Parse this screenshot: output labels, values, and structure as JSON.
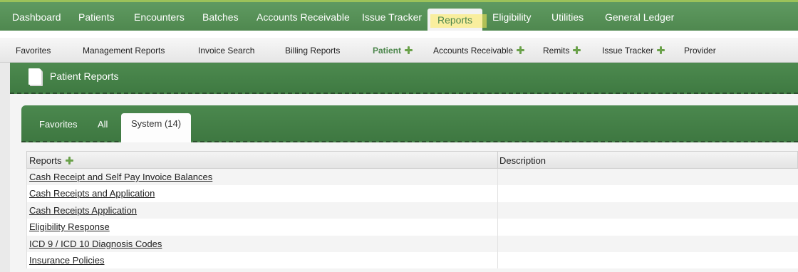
{
  "topnav": {
    "items": [
      {
        "label": "Dashboard"
      },
      {
        "label": "Patients"
      },
      {
        "label": "Encounters"
      },
      {
        "label": "Batches"
      },
      {
        "label": "Accounts Receivable"
      },
      {
        "label": "Issue Tracker"
      },
      {
        "label": "Reports",
        "active": true
      },
      {
        "label": "Eligibility"
      },
      {
        "label": "Utilities"
      },
      {
        "label": "General Ledger"
      }
    ]
  },
  "subnav": {
    "items": [
      {
        "label": "Favorites"
      },
      {
        "label": "Management Reports"
      },
      {
        "label": "Invoice Search"
      },
      {
        "label": "Billing Reports"
      },
      {
        "label": "Patient",
        "active": true,
        "plus": true
      },
      {
        "label": "Accounts Receivable",
        "plus": true
      },
      {
        "label": "Remits",
        "plus": true
      },
      {
        "label": "Issue Tracker",
        "plus": true
      },
      {
        "label": "Provider"
      }
    ]
  },
  "panel": {
    "title": "Patient Reports"
  },
  "tabs": [
    {
      "label": "Favorites"
    },
    {
      "label": "All"
    },
    {
      "label": "System (14)",
      "active": true
    }
  ],
  "table": {
    "columns": [
      "Reports",
      "Description"
    ],
    "rows": [
      {
        "name": "Cash Receipt and Self Pay Invoice Balances",
        "description": ""
      },
      {
        "name": "Cash Receipts and Application",
        "description": ""
      },
      {
        "name": "Cash Receipts Application",
        "description": ""
      },
      {
        "name": "Eligibility Response",
        "description": "",
        "highlighted": true
      },
      {
        "name": "ICD 9 / ICD 10 Diagnosis Codes",
        "description": ""
      },
      {
        "name": "Insurance Policies",
        "description": ""
      }
    ]
  },
  "colors": {
    "primary_green": "#4f884f",
    "accent_lime": "#9cc25a",
    "highlight_yellow": "#ffeb5a"
  }
}
